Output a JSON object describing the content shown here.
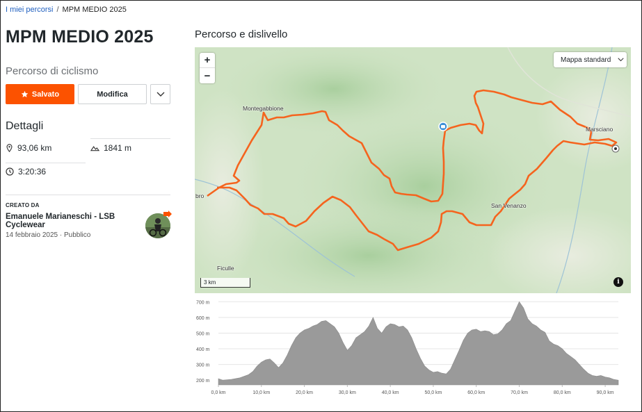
{
  "breadcrumb": {
    "parent": "I miei percorsi",
    "separator": "/",
    "current": "MPM MEDIO 2025"
  },
  "route": {
    "title": "MPM MEDIO 2025",
    "subtitle": "Percorso di ciclismo"
  },
  "actions": {
    "saved_label": "Salvato",
    "edit_label": "Modifica"
  },
  "details": {
    "heading": "Dettagli",
    "distance": "93,06 km",
    "elevation_gain": "1841 m",
    "time": "3:20:36"
  },
  "creator": {
    "label": "CREATO DA",
    "name": "Emanuele Marianeschi - LSB Cyclewear",
    "date": "14 febbraio 2025",
    "dot": "·",
    "visibility": "Pubblico"
  },
  "map_section": {
    "heading": "Percorso e dislivello",
    "zoom_in": "+",
    "zoom_out": "−",
    "map_type": "Mappa standard",
    "scale": "3 km",
    "info": "i",
    "places": {
      "montegabbione": "Montegabbione",
      "marsciano": "Marsciano",
      "san_venanzo": "San Venanzo",
      "ficulle": "Ficulle",
      "fabro": "bro"
    }
  },
  "colors": {
    "accent": "#fc5200",
    "route": "#f5641e",
    "profile": "#9a9a9a",
    "map_bg": "#cfe3c4"
  },
  "chart_data": {
    "type": "area",
    "title": "",
    "xlabel": "",
    "ylabel": "",
    "x_unit": "km",
    "y_unit": "m",
    "xlim": [
      0,
      93.06
    ],
    "ylim": [
      170,
      710
    ],
    "x_ticks": [
      "0,0 km",
      "10,0 km",
      "20,0 km",
      "30,0 km",
      "40,0 km",
      "50,0 km",
      "60,0 km",
      "70,0 km",
      "80,0 km",
      "90,0 km"
    ],
    "y_ticks": [
      "200 m",
      "300 m",
      "400 m",
      "500 m",
      "600 m",
      "700 m"
    ],
    "x": [
      0,
      1,
      3,
      5,
      7,
      8,
      9,
      10,
      11,
      12,
      13,
      14,
      15,
      16,
      17,
      18,
      19,
      20,
      21,
      22,
      23,
      24,
      25,
      26,
      27,
      28,
      29,
      30,
      31,
      32,
      33,
      34,
      35,
      36,
      37,
      38,
      39,
      40,
      41,
      42,
      43,
      44,
      45,
      46,
      47,
      48,
      49,
      50,
      51,
      52,
      53,
      54,
      55,
      56,
      57,
      58,
      59,
      60,
      61,
      62,
      63,
      64,
      65,
      66,
      67,
      68,
      69,
      70,
      71,
      72,
      73,
      74,
      75,
      76,
      77,
      78,
      79,
      80,
      81,
      82,
      83,
      84,
      85,
      86,
      87,
      88,
      89,
      90,
      91,
      92,
      93.06
    ],
    "values": [
      210,
      200,
      205,
      215,
      235,
      255,
      290,
      315,
      330,
      335,
      310,
      280,
      310,
      360,
      420,
      470,
      500,
      520,
      530,
      545,
      555,
      575,
      580,
      560,
      540,
      500,
      440,
      390,
      420,
      470,
      490,
      510,
      545,
      600,
      530,
      500,
      540,
      560,
      555,
      540,
      545,
      520,
      470,
      400,
      340,
      290,
      265,
      250,
      255,
      245,
      240,
      270,
      330,
      390,
      455,
      500,
      520,
      525,
      510,
      515,
      510,
      490,
      495,
      520,
      560,
      580,
      640,
      700,
      660,
      590,
      560,
      545,
      520,
      505,
      450,
      430,
      420,
      400,
      370,
      350,
      330,
      300,
      270,
      245,
      230,
      225,
      230,
      220,
      215,
      205,
      200
    ]
  }
}
